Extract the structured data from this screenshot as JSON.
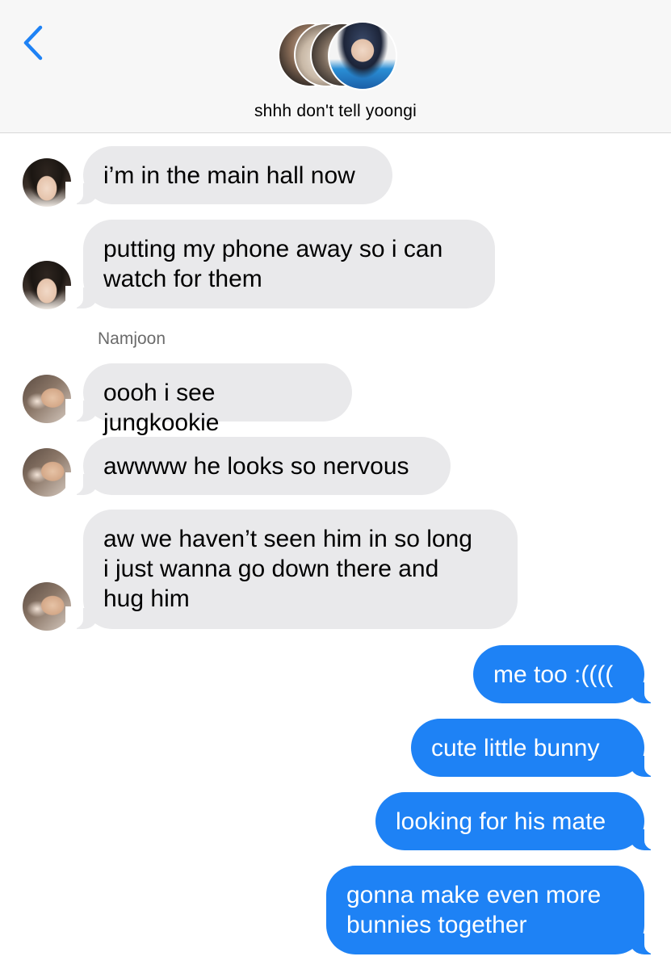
{
  "header": {
    "back_icon": "chevron-left-icon",
    "group_name": "shhh don't tell yoongi",
    "accent_color": "#1e82f5",
    "participant_avatars": [
      "avatar-1",
      "avatar-2",
      "avatar-3",
      "avatar-jimin"
    ]
  },
  "messages": [
    {
      "direction": "incoming",
      "sender": "jungkook",
      "text": "i’m in the main hall now",
      "show_avatar": true
    },
    {
      "direction": "incoming",
      "sender": "jungkook",
      "text": "putting my phone away so i can\nwatch for them",
      "show_avatar": true
    },
    {
      "sender_label": "Namjoon"
    },
    {
      "direction": "incoming",
      "sender": "namjoon",
      "text": "oooh i see jungkookie",
      "show_avatar": true
    },
    {
      "direction": "incoming",
      "sender": "namjoon",
      "text": "awwww he looks so nervous",
      "show_avatar": true
    },
    {
      "direction": "incoming",
      "sender": "namjoon",
      "text": "aw we haven’t seen him in so long\ni just wanna go down there and\nhug him",
      "show_avatar": true
    },
    {
      "direction": "outgoing",
      "text": "me too :(((("
    },
    {
      "direction": "outgoing",
      "text": "cute little bunny"
    },
    {
      "direction": "outgoing",
      "text": "looking for his mate"
    },
    {
      "direction": "outgoing",
      "text": "gonna make even more\nbunnies together"
    }
  ],
  "colors": {
    "incoming_bubble": "#e9e9eb",
    "outgoing_bubble": "#1e82f5",
    "header_bg": "#f7f7f7"
  }
}
